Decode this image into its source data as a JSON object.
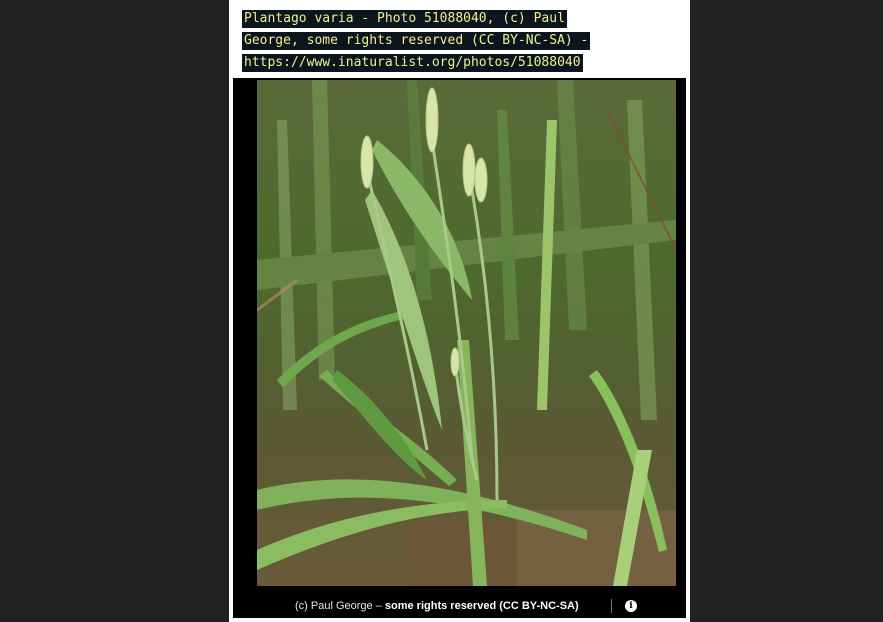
{
  "caption": {
    "lines": [
      "Plantago varia - Photo 51088040, (c) Paul",
      "George, some rights reserved (CC BY-NC-SA) -",
      "https://www.inaturalist.org/photos/51088040"
    ]
  },
  "photo": {
    "subject": "Plantago varia plant with flower spikes among grass"
  },
  "attribution": {
    "author": "(c) Paul George",
    "dash": " – ",
    "rights": "some rights reserved (CC BY-NC-SA)",
    "info_icon": "info-icon"
  },
  "colors": {
    "background": "#222222",
    "caption_bg": "#0a1520",
    "caption_text": "#f4f08a"
  }
}
